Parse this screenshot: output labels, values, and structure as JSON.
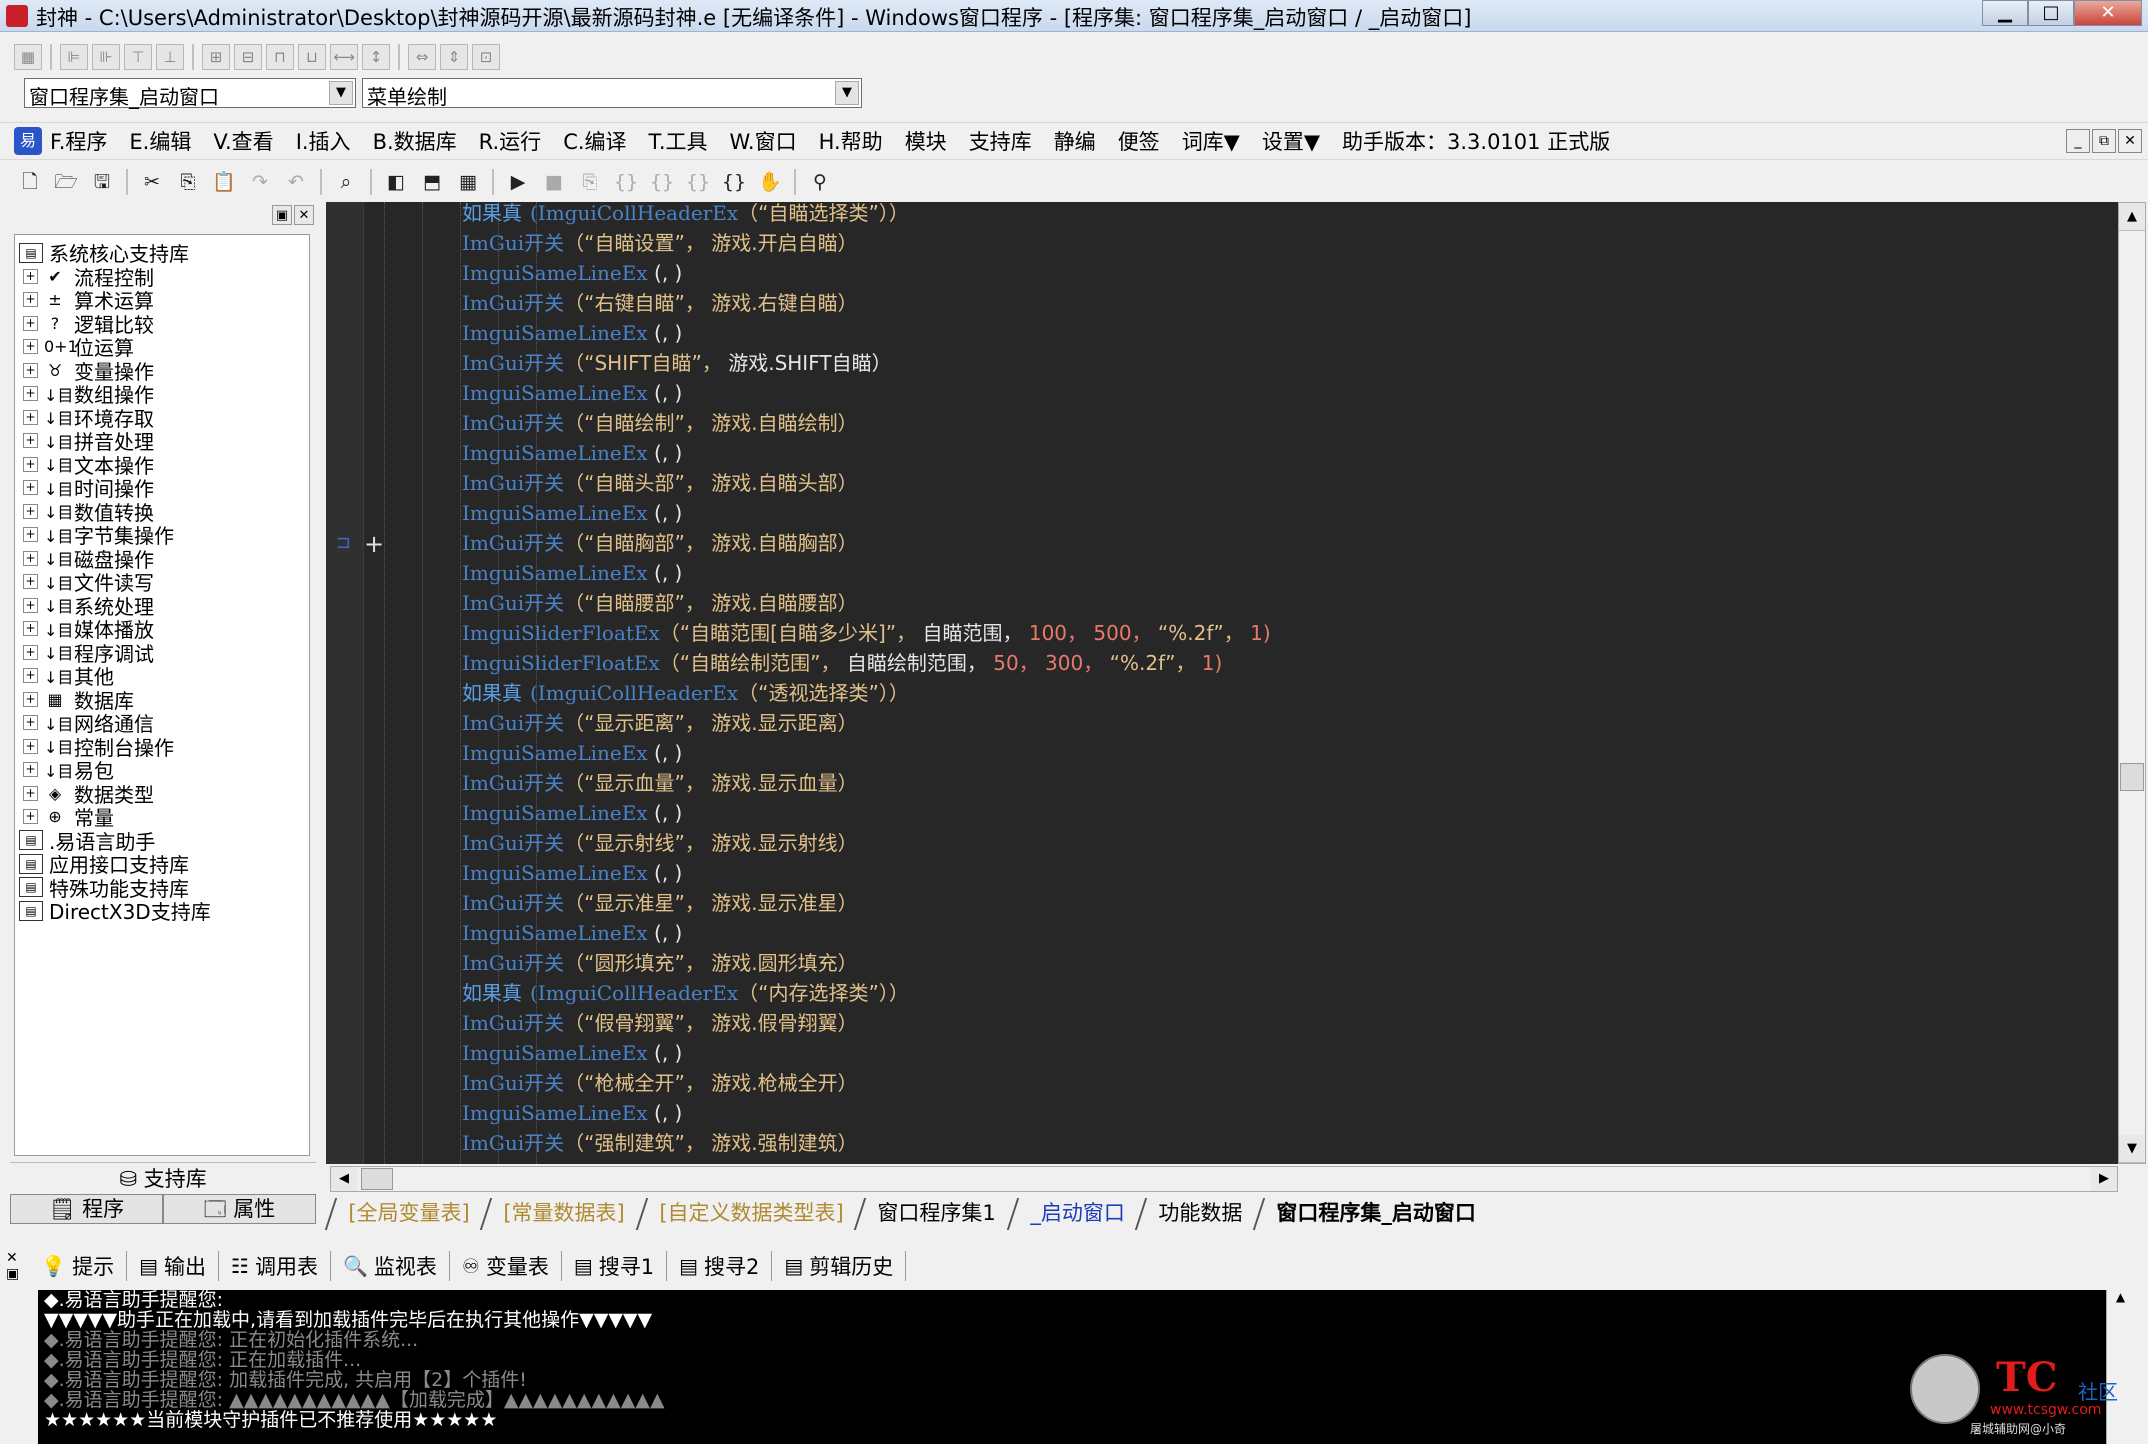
{
  "window": {
    "title": "封神 - C:\\Users\\Administrator\\Desktop\\封神源码开源\\最新源码封神.e [无编译条件] - Windows窗口程序 - [程序集: 窗口程序集_启动窗口 / _启动窗口]",
    "min": "▁",
    "max": "□",
    "close": "✕"
  },
  "selectors": {
    "class_select": "窗口程序集_启动窗口",
    "method_select": "菜单绘制",
    "arrow": "▼"
  },
  "menu": {
    "logo": "易",
    "items": [
      "F.程序",
      "E.编辑",
      "V.查看",
      "I.插入",
      "B.数据库",
      "R.运行",
      "C.编译",
      "T.工具",
      "W.窗口",
      "H.帮助",
      "模块",
      "支持库",
      "静编",
      "便签",
      "词库▼",
      "设置▼",
      "助手版本：3.3.0101 正式版"
    ],
    "mdi_min": "_",
    "mdi_restore": "⧉",
    "mdi_close": "✕"
  },
  "library_tree": {
    "root": "系统核心支持库",
    "children": [
      {
        "icon": "check-icon",
        "glyph": "✔",
        "label": "流程控制"
      },
      {
        "icon": "math-icon",
        "glyph": "±",
        "label": "算术运算"
      },
      {
        "icon": "question-icon",
        "glyph": "?",
        "label": "逻辑比较"
      },
      {
        "icon": "bits-icon",
        "glyph": "0+1",
        "label": "位运算"
      },
      {
        "icon": "variable-icon",
        "glyph": "♉",
        "label": "变量操作"
      },
      {
        "icon": "book-icon",
        "glyph": "↓目",
        "label": "数组操作"
      },
      {
        "icon": "book-icon",
        "glyph": "↓目",
        "label": "环境存取"
      },
      {
        "icon": "book-icon",
        "glyph": "↓目",
        "label": "拼音处理"
      },
      {
        "icon": "book-icon",
        "glyph": "↓目",
        "label": "文本操作"
      },
      {
        "icon": "book-icon",
        "glyph": "↓目",
        "label": "时间操作"
      },
      {
        "icon": "book-icon",
        "glyph": "↓目",
        "label": "数值转换"
      },
      {
        "icon": "book-icon",
        "glyph": "↓目",
        "label": "字节集操作"
      },
      {
        "icon": "book-icon",
        "glyph": "↓目",
        "label": "磁盘操作"
      },
      {
        "icon": "book-icon",
        "glyph": "↓目",
        "label": "文件读写"
      },
      {
        "icon": "book-icon",
        "glyph": "↓目",
        "label": "系统处理"
      },
      {
        "icon": "book-icon",
        "glyph": "↓目",
        "label": "媒体播放"
      },
      {
        "icon": "book-icon",
        "glyph": "↓目",
        "label": "程序调试"
      },
      {
        "icon": "book-icon",
        "glyph": "↓目",
        "label": "其他"
      },
      {
        "icon": "database-icon",
        "glyph": "▦",
        "label": "数据库"
      },
      {
        "icon": "book-icon",
        "glyph": "↓目",
        "label": "网络通信"
      },
      {
        "icon": "book-icon",
        "glyph": "↓目",
        "label": "控制台操作"
      },
      {
        "icon": "book-icon",
        "glyph": "↓目",
        "label": "易包"
      },
      {
        "icon": "datatype-icon",
        "glyph": "◈",
        "label": "数据类型"
      },
      {
        "icon": "constant-icon",
        "glyph": "⊕",
        "label": "常量"
      }
    ],
    "other_libs": [
      ".易语言助手",
      "应用接口支持库",
      "特殊功能支持库",
      "DirectX3D支持库"
    ],
    "footer": "支持库",
    "tab_program": "程序",
    "tab_property": "属性",
    "expander": "+"
  },
  "code_lines": [
    {
      "indent": 1,
      "kw": "如果真",
      "rest": [
        {
          "t": "fn",
          "v": "(ImguiCollHeaderEx"
        },
        {
          "t": "str",
          "v": "（“自瞄选择类”））"
        }
      ]
    },
    {
      "indent": 1,
      "rest": [
        {
          "t": "fn",
          "v": "ImGui开关"
        },
        {
          "t": "str",
          "v": "（“自瞄设置”，"
        },
        {
          "t": "str",
          "v": " 游戏.开启自瞄）"
        }
      ]
    },
    {
      "indent": 1,
      "rest": [
        {
          "t": "fn",
          "v": "ImguiSameLineEx"
        },
        {
          "t": "id",
          "v": " (, )"
        }
      ]
    },
    {
      "indent": 1,
      "rest": [
        {
          "t": "fn",
          "v": "ImGui开关"
        },
        {
          "t": "str",
          "v": "（“右键自瞄”，"
        },
        {
          "t": "str",
          "v": " 游戏.右键自瞄）"
        }
      ]
    },
    {
      "indent": 1,
      "rest": [
        {
          "t": "fn",
          "v": "ImguiSameLineEx"
        },
        {
          "t": "id",
          "v": " (, )"
        }
      ]
    },
    {
      "indent": 1,
      "rest": [
        {
          "t": "fn",
          "v": "ImGui开关"
        },
        {
          "t": "str",
          "v": "（“SHIFT自瞄”，"
        },
        {
          "t": "id",
          "v": " 游戏.SHIFT自瞄）"
        }
      ]
    },
    {
      "indent": 1,
      "rest": [
        {
          "t": "fn",
          "v": "ImguiSameLineEx"
        },
        {
          "t": "id",
          "v": " (, )"
        }
      ]
    },
    {
      "indent": 1,
      "rest": [
        {
          "t": "fn",
          "v": "ImGui开关"
        },
        {
          "t": "str",
          "v": "（“自瞄绘制”，"
        },
        {
          "t": "str",
          "v": " 游戏.自瞄绘制）"
        }
      ]
    },
    {
      "indent": 1,
      "rest": [
        {
          "t": "fn",
          "v": "ImguiSameLineEx"
        },
        {
          "t": "id",
          "v": " (, )"
        }
      ]
    },
    {
      "indent": 1,
      "rest": [
        {
          "t": "fn",
          "v": "ImGui开关"
        },
        {
          "t": "str",
          "v": "（“自瞄头部”，"
        },
        {
          "t": "str",
          "v": " 游戏.自瞄头部）"
        }
      ]
    },
    {
      "indent": 1,
      "rest": [
        {
          "t": "fn",
          "v": "ImguiSameLineEx"
        },
        {
          "t": "id",
          "v": " (, )"
        }
      ]
    },
    {
      "indent": 1,
      "rest": [
        {
          "t": "fn",
          "v": "ImGui开关"
        },
        {
          "t": "str",
          "v": "（“自瞄胸部”，"
        },
        {
          "t": "str",
          "v": " 游戏.自瞄胸部）"
        }
      ]
    },
    {
      "indent": 1,
      "rest": [
        {
          "t": "fn",
          "v": "ImguiSameLineEx"
        },
        {
          "t": "id",
          "v": " (, )"
        }
      ]
    },
    {
      "indent": 1,
      "rest": [
        {
          "t": "fn",
          "v": "ImGui开关"
        },
        {
          "t": "str",
          "v": "（“自瞄腰部”，"
        },
        {
          "t": "str",
          "v": " 游戏.自瞄腰部）"
        }
      ]
    },
    {
      "indent": 1,
      "rest": [
        {
          "t": "fn",
          "v": "ImguiSliderFloatEx"
        },
        {
          "t": "str",
          "v": "（“自瞄范围[自瞄多少米]”，"
        },
        {
          "t": "id",
          "v": " 自瞄范围，"
        },
        {
          "t": "num",
          "v": " 100，"
        },
        {
          "t": "num",
          "v": " 500，"
        },
        {
          "t": "str",
          "v": " “%.2f”，"
        },
        {
          "t": "num",
          "v": " 1)"
        }
      ]
    },
    {
      "indent": 1,
      "rest": [
        {
          "t": "fn",
          "v": "ImguiSliderFloatEx"
        },
        {
          "t": "str",
          "v": "（“自瞄绘制范围”，"
        },
        {
          "t": "id",
          "v": " 自瞄绘制范围，"
        },
        {
          "t": "num",
          "v": " 50，"
        },
        {
          "t": "num",
          "v": " 300，"
        },
        {
          "t": "str",
          "v": " “%.2f”，"
        },
        {
          "t": "num",
          "v": " 1)"
        }
      ]
    },
    {
      "indent": 1,
      "kw": "如果真",
      "rest": [
        {
          "t": "fn",
          "v": "(ImguiCollHeaderEx"
        },
        {
          "t": "str",
          "v": "（“透视选择类”））"
        }
      ]
    },
    {
      "indent": 1,
      "rest": [
        {
          "t": "fn",
          "v": "ImGui开关"
        },
        {
          "t": "str",
          "v": "（“显示距离”，"
        },
        {
          "t": "str",
          "v": " 游戏.显示距离）"
        }
      ]
    },
    {
      "indent": 1,
      "rest": [
        {
          "t": "fn",
          "v": "ImguiSameLineEx"
        },
        {
          "t": "id",
          "v": " (, )"
        }
      ]
    },
    {
      "indent": 1,
      "rest": [
        {
          "t": "fn",
          "v": "ImGui开关"
        },
        {
          "t": "str",
          "v": "（“显示血量”，"
        },
        {
          "t": "str",
          "v": " 游戏.显示血量）"
        }
      ]
    },
    {
      "indent": 1,
      "rest": [
        {
          "t": "fn",
          "v": "ImguiSameLineEx"
        },
        {
          "t": "id",
          "v": " (, )"
        }
      ]
    },
    {
      "indent": 1,
      "rest": [
        {
          "t": "fn",
          "v": "ImGui开关"
        },
        {
          "t": "str",
          "v": "（“显示射线”，"
        },
        {
          "t": "str",
          "v": " 游戏.显示射线）"
        }
      ]
    },
    {
      "indent": 1,
      "rest": [
        {
          "t": "fn",
          "v": "ImguiSameLineEx"
        },
        {
          "t": "id",
          "v": " (, )"
        }
      ]
    },
    {
      "indent": 1,
      "rest": [
        {
          "t": "fn",
          "v": "ImGui开关"
        },
        {
          "t": "str",
          "v": "（“显示准星”，"
        },
        {
          "t": "str",
          "v": " 游戏.显示准星）"
        }
      ]
    },
    {
      "indent": 1,
      "rest": [
        {
          "t": "fn",
          "v": "ImguiSameLineEx"
        },
        {
          "t": "id",
          "v": " (, )"
        }
      ]
    },
    {
      "indent": 1,
      "rest": [
        {
          "t": "fn",
          "v": "ImGui开关"
        },
        {
          "t": "str",
          "v": "（“圆形填充”，"
        },
        {
          "t": "str",
          "v": " 游戏.圆形填充）"
        }
      ]
    },
    {
      "indent": 1,
      "kw": "如果真",
      "rest": [
        {
          "t": "fn",
          "v": "(ImguiCollHeaderEx"
        },
        {
          "t": "str",
          "v": "（“内存选择类”））"
        }
      ]
    },
    {
      "indent": 1,
      "rest": [
        {
          "t": "fn",
          "v": "ImGui开关"
        },
        {
          "t": "str",
          "v": "（“假骨翔翼”，"
        },
        {
          "t": "str",
          "v": " 游戏.假骨翔翼）"
        }
      ]
    },
    {
      "indent": 1,
      "rest": [
        {
          "t": "fn",
          "v": "ImguiSameLineEx"
        },
        {
          "t": "id",
          "v": " (, )"
        }
      ]
    },
    {
      "indent": 1,
      "rest": [
        {
          "t": "fn",
          "v": "ImGui开关"
        },
        {
          "t": "str",
          "v": "（“枪械全开”，"
        },
        {
          "t": "str",
          "v": " 游戏.枪械全开）"
        }
      ]
    },
    {
      "indent": 1,
      "rest": [
        {
          "t": "fn",
          "v": "ImguiSameLineEx"
        },
        {
          "t": "id",
          "v": " (, )"
        }
      ]
    },
    {
      "indent": 1,
      "rest": [
        {
          "t": "fn",
          "v": "ImGui开关"
        },
        {
          "t": "str",
          "v": "（“强制建筑”，"
        },
        {
          "t": "str",
          "v": " 游戏.强制建筑）"
        }
      ]
    }
  ],
  "editor_tabs": [
    "[全局变量表]",
    "[常量数据表]",
    "[自定义数据类型表]",
    "窗口程序集1",
    "_启动窗口",
    "功能数据",
    "窗口程序集_启动窗口"
  ],
  "bottom_tabs": [
    {
      "icon": "hint-icon",
      "glyph": "💡",
      "label": "提示"
    },
    {
      "icon": "output-icon",
      "glyph": "▤",
      "label": "输出"
    },
    {
      "icon": "calltable-icon",
      "glyph": "☷",
      "label": "调用表"
    },
    {
      "icon": "watch-icon",
      "glyph": "🔍",
      "label": "监视表"
    },
    {
      "icon": "variables-icon",
      "glyph": "♾",
      "label": "变量表"
    },
    {
      "icon": "search1-icon",
      "glyph": "▤",
      "label": "搜寻1"
    },
    {
      "icon": "search2-icon",
      "glyph": "▤",
      "label": "搜寻2"
    },
    {
      "icon": "clipboard-icon",
      "glyph": "▤",
      "label": "剪辑历史"
    }
  ],
  "output_lines": [
    "◆.易语言助手提醒您:",
    "▼▼▼▼▼助手正在加载中,请看到加载插件完毕后在执行其他操作▼▼▼▼▼",
    "◆.易语言助手提醒您: 正在初始化插件系统...",
    "◆.易语言助手提醒您: 正在加载插件...",
    "◆.易语言助手提醒您: 加载插件完成, 共启用【2】个插件!",
    "◆.易语言助手提醒您: ▲▲▲▲▲▲▲▲▲▲▲【加载完成】▲▲▲▲▲▲▲▲▲▲▲",
    "★★★★★★当前模块守护插件已不推荐使用★★★★★"
  ],
  "watermark": {
    "brand": "TC",
    "community": "社区",
    "url": "www.tcsgw.com",
    "by": "屠城辅助网@小奇"
  },
  "colors": {
    "editor_bg": "#272727",
    "keyword": "#5aa0e6",
    "string": "#e0c08a",
    "number": "#e87a6a"
  }
}
